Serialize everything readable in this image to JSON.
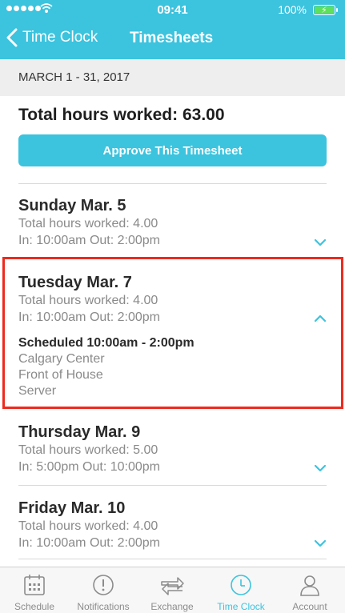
{
  "status_bar": {
    "time": "09:41",
    "battery": "100%"
  },
  "nav": {
    "back_label": "Time Clock",
    "title": "Timesheets"
  },
  "date_range": "MARCH 1 - 31, 2017",
  "summary": {
    "total_hours": "Total hours worked: 63.00",
    "approve_label": "Approve This Timesheet"
  },
  "days": [
    {
      "title": "Sunday Mar. 5",
      "hours": "Total hours worked: 4.00",
      "inout": "In: 10:00am Out: 2:00pm"
    },
    {
      "title": "Tuesday Mar. 7",
      "hours": "Total hours worked: 4.00",
      "inout": "In: 10:00am Out: 2:00pm",
      "scheduled": "Scheduled 10:00am - 2:00pm",
      "location": "Calgary Center",
      "area": "Front of House",
      "role": "Server"
    },
    {
      "title": "Thursday Mar. 9",
      "hours": "Total hours worked: 5.00",
      "inout": "In: 5:00pm Out: 10:00pm"
    },
    {
      "title": "Friday Mar. 10",
      "hours": "Total hours worked: 4.00",
      "inout": "In: 10:00am Out: 2:00pm"
    }
  ],
  "tabs": [
    {
      "label": "Schedule",
      "icon": "calendar-icon"
    },
    {
      "label": "Notifications",
      "icon": "alert-icon"
    },
    {
      "label": "Exchange",
      "icon": "exchange-icon"
    },
    {
      "label": "Time Clock",
      "icon": "clock-icon",
      "active": true
    },
    {
      "label": "Account",
      "icon": "person-icon"
    }
  ],
  "colors": {
    "accent": "#3cc3de",
    "highlight": "#ee2a1e",
    "battery_fill": "#5ee05e"
  }
}
